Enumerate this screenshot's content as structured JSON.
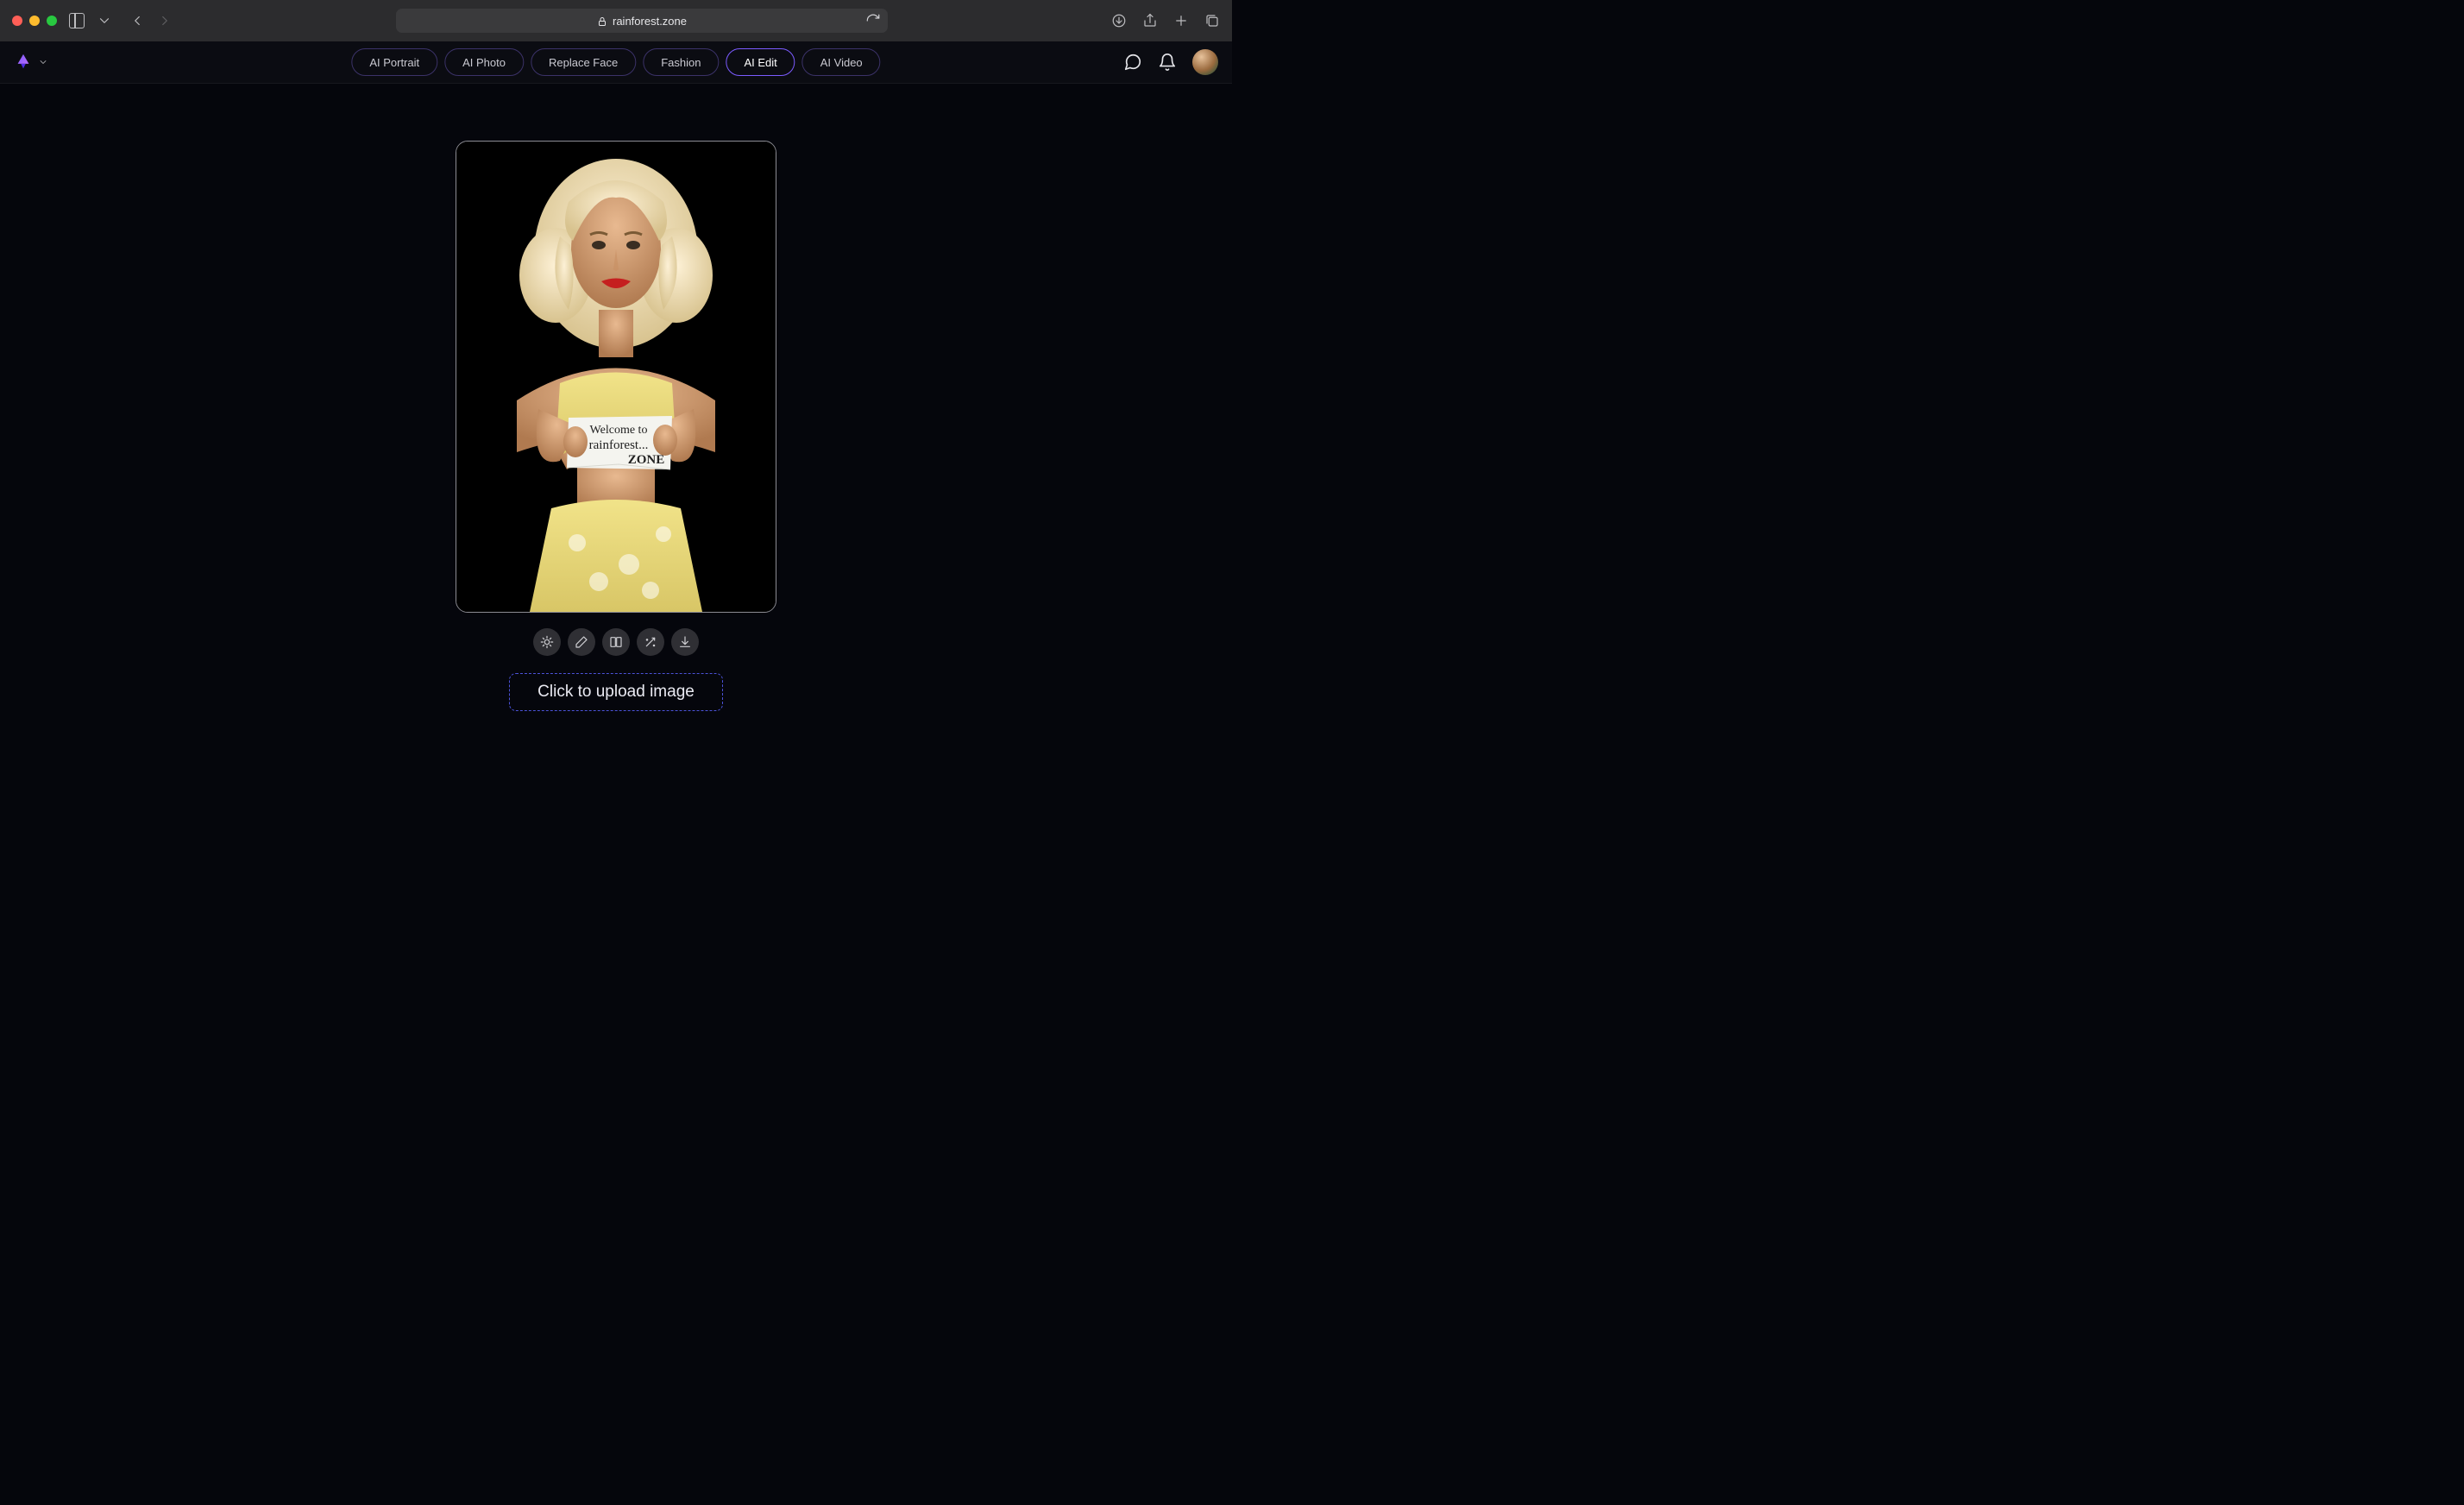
{
  "browser": {
    "url": "rainforest.zone"
  },
  "nav": {
    "tabs": [
      {
        "label": "AI Portrait",
        "active": false
      },
      {
        "label": "AI Photo",
        "active": false
      },
      {
        "label": "Replace Face",
        "active": false
      },
      {
        "label": "Fashion",
        "active": false
      },
      {
        "label": "AI Edit",
        "active": true
      },
      {
        "label": "AI Video",
        "active": false
      }
    ]
  },
  "sample": {
    "note_line1": "Welcome to",
    "note_line2": "rainforest...",
    "note_line3": "ZONE"
  },
  "tools": [
    {
      "name": "enhance-icon"
    },
    {
      "name": "edit-icon"
    },
    {
      "name": "compare-icon"
    },
    {
      "name": "magic-icon"
    },
    {
      "name": "download-icon"
    }
  ],
  "upload": {
    "cta": "Click to upload image"
  }
}
